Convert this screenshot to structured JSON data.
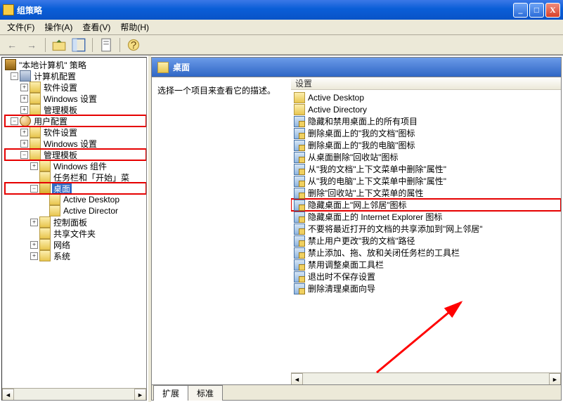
{
  "window": {
    "title": "组策略"
  },
  "menu": {
    "file": "文件(F)",
    "action": "操作(A)",
    "view": "查看(V)",
    "help": "帮助(H)"
  },
  "tree": {
    "root": "\"本地计算机\" 策略",
    "computer_config": "计算机配置",
    "software_settings": "软件设置",
    "windows_settings": "Windows 设置",
    "admin_templates": "管理模板",
    "user_config": "用户配置",
    "windows_components": "Windows 组件",
    "taskbar_start": "任务栏和「开始」菜",
    "desktop": "桌面",
    "active_desktop": "Active Desktop",
    "active_directory": "Active Director",
    "control_panel": "控制面板",
    "shared_folders": "共享文件夹",
    "network": "网络",
    "system": "系统"
  },
  "right": {
    "title": "桌面",
    "desc": "选择一个项目来查看它的描述。",
    "col_header": "设置",
    "items": [
      {
        "t": "folder",
        "label": "Active Desktop"
      },
      {
        "t": "folder",
        "label": "Active Directory"
      },
      {
        "t": "setting",
        "label": "隐藏和禁用桌面上的所有项目"
      },
      {
        "t": "setting",
        "label": "删除桌面上的\"我的文档\"图标"
      },
      {
        "t": "setting",
        "label": "删除桌面上的\"我的电脑\"图标"
      },
      {
        "t": "setting",
        "label": "从桌面删除\"回收站\"图标"
      },
      {
        "t": "setting",
        "label": "从\"我的文档\"上下文菜单中删除\"属性\""
      },
      {
        "t": "setting",
        "label": "从\"我的电脑\"上下文菜单中删除\"属性\""
      },
      {
        "t": "setting",
        "label": "删除\"回收站\"上下文菜单的属性"
      },
      {
        "t": "setting",
        "label": "隐藏桌面上\"网上邻居\"图标",
        "hl": true
      },
      {
        "t": "setting",
        "label": "隐藏桌面上的 Internet Explorer 图标"
      },
      {
        "t": "setting",
        "label": "不要将最近打开的文档的共享添加到\"网上邻居\""
      },
      {
        "t": "setting",
        "label": "禁止用户更改\"我的文档\"路径"
      },
      {
        "t": "setting",
        "label": "禁止添加、拖、放和关闭任务栏的工具栏"
      },
      {
        "t": "setting",
        "label": "禁用调整桌面工具栏"
      },
      {
        "t": "setting",
        "label": "退出时不保存设置"
      },
      {
        "t": "setting",
        "label": "删除清理桌面向导"
      }
    ]
  },
  "tabs": {
    "extended": "扩展",
    "standard": "标准"
  }
}
